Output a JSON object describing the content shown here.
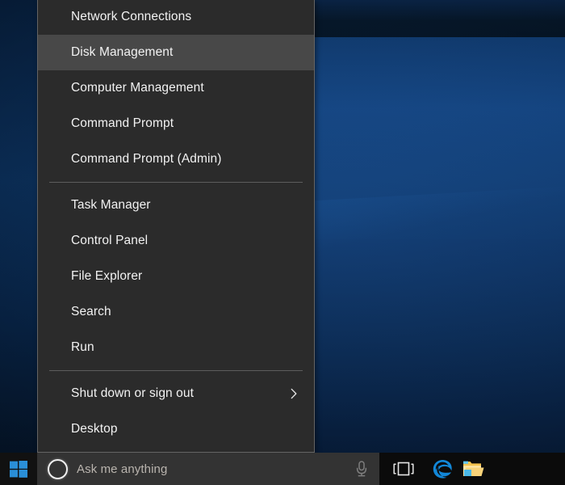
{
  "desktop": {
    "wallpaper_name": "windows-10-hero-blue",
    "colors": {
      "wallpaper_dark": "#061627",
      "wallpaper_mid": "#14437e",
      "wallpaper_deep": "#0b2950",
      "accent_blue": "#1287d8"
    }
  },
  "winx_menu": {
    "name": "win-x-quick-link-menu",
    "background": "#2b2b2b",
    "border_color": "#646464",
    "selected_background": "#484848",
    "groups": [
      {
        "items": [
          {
            "label": "Network Connections",
            "selected": false,
            "submenu": false
          },
          {
            "label": "Disk Management",
            "selected": true,
            "submenu": false
          },
          {
            "label": "Computer Management",
            "selected": false,
            "submenu": false
          },
          {
            "label": "Command Prompt",
            "selected": false,
            "submenu": false
          },
          {
            "label": "Command Prompt (Admin)",
            "selected": false,
            "submenu": false
          }
        ]
      },
      {
        "items": [
          {
            "label": "Task Manager",
            "selected": false,
            "submenu": false
          },
          {
            "label": "Control Panel",
            "selected": false,
            "submenu": false
          },
          {
            "label": "File Explorer",
            "selected": false,
            "submenu": false
          },
          {
            "label": "Search",
            "selected": false,
            "submenu": false
          },
          {
            "label": "Run",
            "selected": false,
            "submenu": false
          }
        ]
      },
      {
        "items": [
          {
            "label": "Shut down or sign out",
            "selected": false,
            "submenu": true,
            "submenu_icon": "chevron-right-icon"
          },
          {
            "label": "Desktop",
            "selected": false,
            "submenu": false
          }
        ]
      }
    ]
  },
  "taskbar": {
    "background": "#0b0b0b",
    "start_button": {
      "icon": "windows-logo-icon",
      "color": "#2a8fd8"
    },
    "search": {
      "placeholder": "Ask me anything",
      "value": "",
      "cortana_icon": "cortana-ring-icon",
      "mic_icon": "microphone-icon",
      "background": "#333333"
    },
    "tray_icons": [
      {
        "name": "task-view-icon",
        "label": "Task View"
      },
      {
        "name": "edge-browser-icon",
        "label": "Microsoft Edge",
        "glyph": "e",
        "color": "#1287d8"
      },
      {
        "name": "file-explorer-icon",
        "label": "File Explorer"
      }
    ]
  }
}
